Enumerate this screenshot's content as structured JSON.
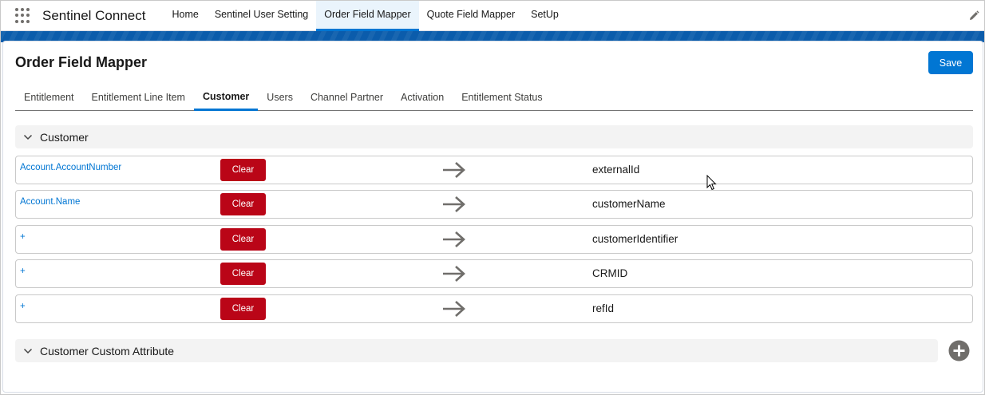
{
  "app": {
    "name": "Sentinel Connect"
  },
  "nav": {
    "items": [
      {
        "label": "Home"
      },
      {
        "label": "Sentinel User Setting"
      },
      {
        "label": "Order Field Mapper"
      },
      {
        "label": "Quote Field Mapper"
      },
      {
        "label": "SetUp"
      }
    ],
    "active_index": 2
  },
  "page": {
    "title": "Order Field Mapper",
    "save_label": "Save"
  },
  "tabs": {
    "items": [
      {
        "label": "Entitlement"
      },
      {
        "label": "Entitlement Line Item"
      },
      {
        "label": "Customer"
      },
      {
        "label": "Users"
      },
      {
        "label": "Channel Partner"
      },
      {
        "label": "Activation"
      },
      {
        "label": "Entitlement Status"
      }
    ],
    "active_index": 2
  },
  "sections": {
    "customer": {
      "title": "Customer"
    },
    "custom_attribute": {
      "title": "Customer Custom Attribute"
    }
  },
  "mappings": [
    {
      "source": "Account.AccountNumber",
      "clear_label": "Clear",
      "target": "externalId"
    },
    {
      "source": "Account.Name",
      "clear_label": "Clear",
      "target": "customerName"
    },
    {
      "source": "+",
      "clear_label": "Clear",
      "target": "customerIdentifier"
    },
    {
      "source": "+",
      "clear_label": "Clear",
      "target": "CRMID"
    },
    {
      "source": "+",
      "clear_label": "Clear",
      "target": "refId"
    }
  ],
  "colors": {
    "brand_blue": "#0176d3",
    "clear_red": "#ba0517",
    "header_band": "#0b5cab"
  },
  "icons": {
    "app_launcher": "waffle-icon",
    "edit": "pencil-icon",
    "collapse": "chevron-down-icon",
    "map": "arrow-right-icon",
    "add": "add-circle-icon"
  }
}
